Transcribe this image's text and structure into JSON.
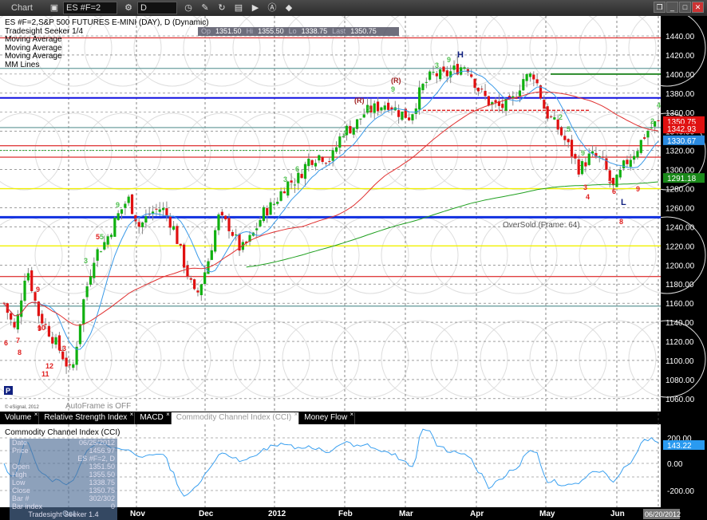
{
  "window": {
    "title": "Chart",
    "symbol": "ES #F=2",
    "interval": "D"
  },
  "toolbar_icons": [
    "link-icon",
    "settings-icon",
    "clock-icon",
    "pencil-icon",
    "refresh-icon",
    "studies-icon",
    "play-icon",
    "alert-icon",
    "eraser-icon"
  ],
  "legend": [
    "ES #F=2,S&P 500 FUTURES E-MINI (DAY), D (Dynamic)",
    "Tradesight Seeker 1/4",
    "Moving Average",
    "Moving Average",
    "Moving Average",
    "MM Lines"
  ],
  "ohlc": {
    "o_label": "Op",
    "o": "1351.50",
    "h_label": "Hi",
    "h": "1355.50",
    "l_label": "Lo",
    "l": "1338.75",
    "last_label": "Last",
    "last": "1350.75"
  },
  "annotations": {
    "H": "H",
    "L": "L",
    "R": "(R)",
    "oversold": "OverSold (Frame: 64)",
    "autoframe": "AutoFrame is OFF",
    "copyright": "© eSignal, 2012",
    "p": "P"
  },
  "price_axis": [
    "1440.00",
    "1420.00",
    "1400.00",
    "1380.00",
    "1360.00",
    "1340.00",
    "1320.00",
    "1300.00",
    "1280.00",
    "1260.00",
    "1240.00",
    "1220.00",
    "1200.00",
    "1180.00",
    "1160.00",
    "1140.00",
    "1120.00",
    "1100.00",
    "1080.00",
    "1060.00"
  ],
  "price_tags": [
    {
      "v": "1350.75",
      "c": "#e01010"
    },
    {
      "v": "1342.93",
      "c": "#e01010"
    },
    {
      "v": "1330.67",
      "c": "#2a8ae0"
    },
    {
      "v": "1291.18",
      "c": "#1a8a1a"
    }
  ],
  "tabs": [
    "Volume",
    "Relative Strength Index",
    "MACD",
    "Commodity Channel Index (CCI)",
    "Money Flow"
  ],
  "active_tab": 3,
  "cci": {
    "title": "Commodity Channel Index (CCI)",
    "axis": [
      "200.00",
      "0.00",
      "-200.00"
    ],
    "value": "143.22"
  },
  "tooltip": {
    "rows": [
      [
        "Date",
        "06/25/2012"
      ],
      [
        "Price",
        "1456.97"
      ],
      [
        "",
        "ES #F=2, D"
      ],
      [
        "Open",
        "1351.50"
      ],
      [
        "High",
        "1355.50"
      ],
      [
        "Low",
        "1338.75"
      ],
      [
        "Close",
        "1350.75"
      ],
      [
        "Bar #",
        "302/302"
      ],
      [
        "Bar index",
        "0"
      ]
    ],
    "footer": "Tradesight Seeker 1.4"
  },
  "x_axis": [
    "Oct",
    "Nov",
    "Dec",
    "2012",
    "Feb",
    "Mar",
    "Apr",
    "May",
    "Jun"
  ],
  "current_date": "06/20/2012",
  "chart_data": {
    "type": "candlestick",
    "ylim": [
      1060,
      1440
    ],
    "weekly_closes": [
      1160,
      1130,
      1200,
      1150,
      1130,
      1110,
      1085,
      1160,
      1210,
      1225,
      1250,
      1270,
      1240,
      1255,
      1260,
      1240,
      1200,
      1165,
      1200,
      1250,
      1240,
      1215,
      1230,
      1255,
      1265,
      1285,
      1290,
      1310,
      1315,
      1310,
      1340,
      1345,
      1360,
      1365,
      1370,
      1360,
      1355,
      1385,
      1400,
      1398,
      1405,
      1410,
      1385,
      1370,
      1365,
      1370,
      1395,
      1400,
      1360,
      1345,
      1325,
      1300,
      1315,
      1310,
      1280,
      1305,
      1320,
      1340,
      1351
    ],
    "levels": [
      {
        "p": 1438,
        "c": "#e04040"
      },
      {
        "p": 1406,
        "c": "#7aa8a8"
      },
      {
        "p": 1375,
        "c": "#1010e0"
      },
      {
        "p": 1344,
        "c": "#7aa8a8"
      },
      {
        "p": 1325,
        "c": "#e04040"
      },
      {
        "p": 1313,
        "c": "#e04040"
      },
      {
        "p": 1280,
        "c": "#f0f000"
      },
      {
        "p": 1250,
        "c": "#1030e0"
      },
      {
        "p": 1220,
        "c": "#f0f000"
      },
      {
        "p": 1188,
        "c": "#e04040"
      },
      {
        "p": 1157,
        "c": "#7aa8a8"
      }
    ],
    "moving_averages": [
      {
        "period": 10,
        "c": "#3a9ae8"
      },
      {
        "period": 50,
        "c": "#e03030"
      },
      {
        "period": 200,
        "c": "#20a020"
      }
    ]
  }
}
